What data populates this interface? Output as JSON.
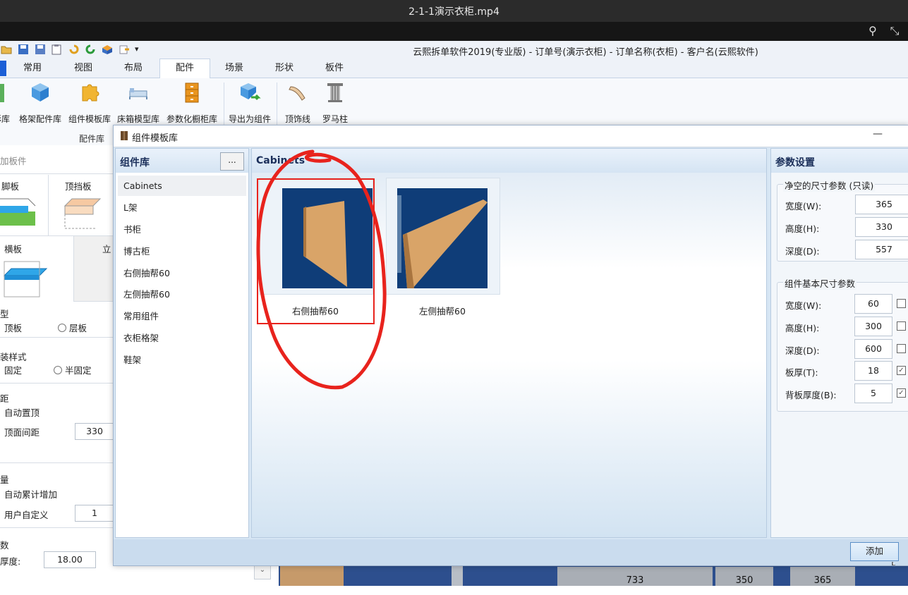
{
  "video": {
    "title": "2-1-1演示衣柜.mp4"
  },
  "app": {
    "title": "云熙拆单软件2019(专业版) - 订单号(演示衣柜) - 订单名称(衣柜) - 客户名(云熙软件)"
  },
  "ribbon": {
    "tabs": [
      "常用",
      "视图",
      "布局",
      "配件",
      "场景",
      "形状",
      "板件"
    ],
    "active_tab": "配件",
    "buttons": [
      "彩库",
      "格架配件库",
      "组件模板库",
      "床箱模型库",
      "参数化橱柜库",
      "导出为组件",
      "顶饰线",
      "罗马柱"
    ],
    "group_label": "配件库"
  },
  "left_panel": {
    "header": "加板件",
    "tiles": [
      "脚板",
      "顶挡板",
      "横板",
      "立"
    ],
    "section_type": "型",
    "type_options": [
      "顶板",
      "层板"
    ],
    "section_style": "装样式",
    "style_options": [
      "固定",
      "半固定"
    ],
    "section_pos": "距",
    "pos_options": [
      "自动置顶",
      "顶面间距"
    ],
    "top_distance": "330",
    "section_count": "量",
    "count_options": [
      "自动累计增加",
      "用户自定义"
    ],
    "custom_count": "1",
    "section_thickness": "数",
    "thickness_label": "厚度:",
    "thickness_value": "18.00"
  },
  "background_cells": [
    "733",
    "350",
    "365"
  ],
  "dialog": {
    "title": "组件模板库",
    "minimize": "—",
    "library": {
      "header": "组件库",
      "more_button": "...",
      "items": [
        "Cabinets",
        "L架",
        "书柜",
        "博古柜",
        "右侧抽帮60",
        "左侧抽帮60",
        "常用组件",
        "衣柜格架",
        "鞋架"
      ],
      "selected": "Cabinets"
    },
    "center": {
      "header": "Cabinets",
      "thumbnails": [
        "右侧抽帮60",
        "左侧抽帮60"
      ]
    },
    "params": {
      "header": "参数设置",
      "clear_group": {
        "title": "净空的尺寸参数 (只读)",
        "rows": [
          {
            "label": "宽度(W):",
            "value": "365"
          },
          {
            "label": "高度(H):",
            "value": "330"
          },
          {
            "label": "深度(D):",
            "value": "557"
          }
        ]
      },
      "base_group": {
        "title": "组件基本尺寸参数",
        "rows": [
          {
            "label": "宽度(W):",
            "value": "60",
            "checked": false
          },
          {
            "label": "高度(H):",
            "value": "300",
            "checked": false
          },
          {
            "label": "深度(D):",
            "value": "600",
            "checked": false
          },
          {
            "label": "板厚(T):",
            "value": "18",
            "checked": true
          },
          {
            "label": "背板厚度(B):",
            "value": "5",
            "checked": true
          }
        ]
      }
    },
    "add_button": "添加"
  },
  "colors": {
    "accent": "#1c5fd6",
    "annotation": "#e8231d",
    "thumb_bg": "#0f3d78",
    "wood": "#d9a468"
  }
}
